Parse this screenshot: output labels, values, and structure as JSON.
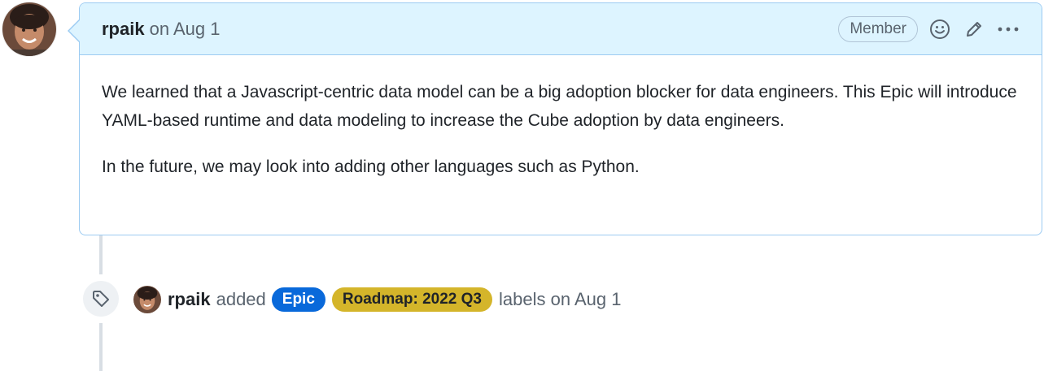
{
  "comment": {
    "author": "rpaik",
    "meta": "on Aug 1",
    "role_badge": "Member",
    "paragraphs": [
      "We learned that a Javascript-centric data model can be a big adoption blocker for data engineers. This Epic will introduce YAML-based runtime and data modeling to increase the Cube adoption by data engineers.",
      "In the future, we may look into adding other languages such as Python."
    ],
    "icons": [
      "smiley-icon",
      "pencil-icon",
      "kebab-menu-icon"
    ]
  },
  "event": {
    "actor": "rpaik",
    "action": "added",
    "labels": [
      {
        "name": "Epic",
        "color": "#0969da"
      },
      {
        "name": "Roadmap: 2022 Q3",
        "color": "#d4b52a"
      }
    ],
    "suffix": "labels on Aug 1",
    "icon": "tag-icon"
  },
  "colors": {
    "header_bg": "#ddf4ff",
    "border": "#9ccbf2"
  }
}
